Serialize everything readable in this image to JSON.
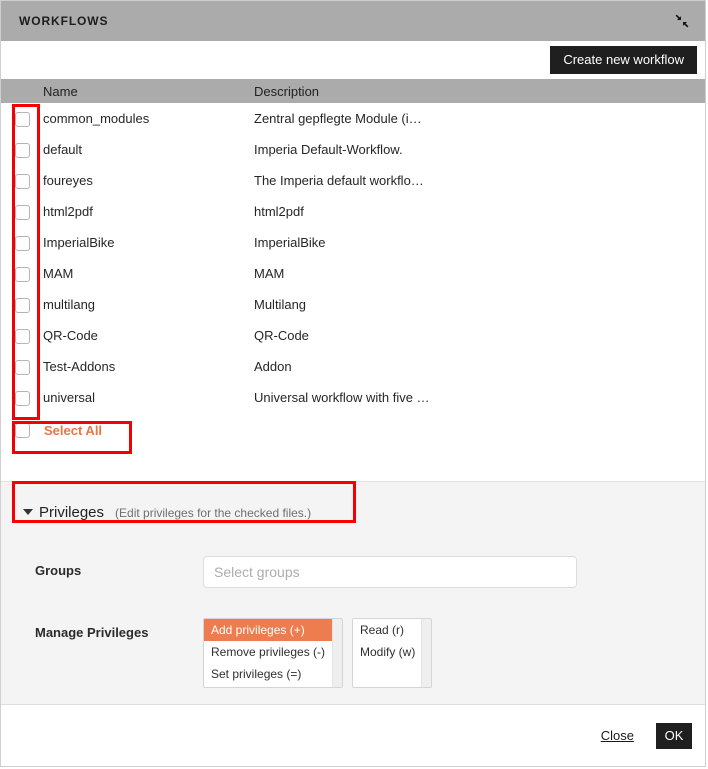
{
  "window": {
    "title": "WORKFLOWS",
    "collapse_icon": "collapse-diagonal-icon"
  },
  "toolbar": {
    "create_label": "Create new workflow"
  },
  "table": {
    "columns": [
      "Name",
      "Description"
    ],
    "rows": [
      {
        "name": "common_modules",
        "description": "Zentral gepflegte Module (i…"
      },
      {
        "name": "default",
        "description": "Imperia Default-Workflow."
      },
      {
        "name": "foureyes",
        "description": "The Imperia default workflo…"
      },
      {
        "name": "html2pdf",
        "description": "html2pdf"
      },
      {
        "name": "ImperialBike",
        "description": "ImperialBike"
      },
      {
        "name": "MAM",
        "description": "MAM"
      },
      {
        "name": "multilang",
        "description": "Multilang"
      },
      {
        "name": "QR-Code",
        "description": "QR-Code"
      },
      {
        "name": "Test-Addons",
        "description": "Addon"
      },
      {
        "name": "universal",
        "description": "Universal workflow with five …"
      }
    ],
    "select_all_label": "Select All"
  },
  "privileges": {
    "section_title": "Privileges",
    "section_note": "(Edit privileges for the checked files.)",
    "groups_label": "Groups",
    "groups_placeholder": "Select groups",
    "groups_value": "",
    "manage_label": "Manage Privileges",
    "action_options": [
      {
        "label": "Add privileges (+)",
        "selected": true
      },
      {
        "label": "Remove privileges (-)",
        "selected": false
      },
      {
        "label": "Set privileges (=)",
        "selected": false
      }
    ],
    "right_options": [
      {
        "label": "Read (r)",
        "selected": false
      },
      {
        "label": "Modify (w)",
        "selected": false
      }
    ]
  },
  "footer": {
    "close_label": "Close",
    "ok_label": "OK"
  },
  "colors": {
    "titlebar": "#ababab",
    "accent_orange": "#ed7d4e",
    "select_all_orange": "#e8763f",
    "button_dark": "#1f1f1f",
    "annotation_red": "#f40000",
    "panel_bg": "#f4f4f4"
  }
}
